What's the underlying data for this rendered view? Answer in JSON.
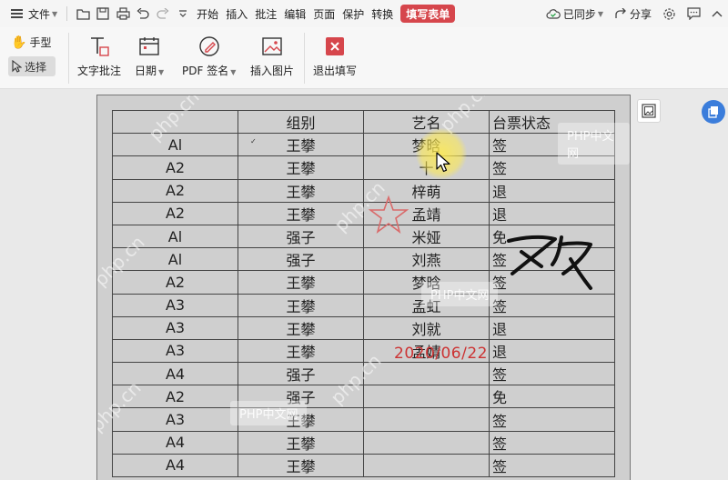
{
  "menubar": {
    "file_label": "文件",
    "tabs": [
      "开始",
      "插入",
      "批注",
      "编辑",
      "页面",
      "保护",
      "转换"
    ],
    "active_tab": "填写表单",
    "sync_label": "已同步",
    "share_label": "分享"
  },
  "ribbon": {
    "hand_label": "手型",
    "select_label": "选择",
    "text_comment_label": "文字批注",
    "date_label": "日期",
    "pdf_sign_label": "PDF 签名",
    "insert_image_label": "插入图片",
    "exit_fill_label": "退出填写"
  },
  "table": {
    "headers": [
      "",
      "组别",
      "艺名",
      "台票状态"
    ],
    "rows": [
      [
        "Al",
        "王攀",
        "梦晗",
        "签"
      ],
      [
        "A2",
        "王攀",
        "十",
        "签"
      ],
      [
        "A2",
        "王攀",
        "梓萌",
        "退"
      ],
      [
        "A2",
        "王攀",
        "孟靖",
        "退"
      ],
      [
        "Al",
        "强子",
        "米娅",
        "免"
      ],
      [
        "Al",
        "强子",
        "刘燕",
        "签"
      ],
      [
        "A2",
        "王攀",
        "梦晗",
        "签"
      ],
      [
        "A3",
        "王攀",
        "孟虹",
        "签"
      ],
      [
        "A3",
        "王攀",
        "刘就",
        "退"
      ],
      [
        "A3",
        "王攀",
        "孟婧",
        "退"
      ],
      [
        "A4",
        "强子",
        "",
        "签"
      ],
      [
        "A2",
        "强子",
        "",
        "免"
      ],
      [
        "A3",
        "王攀",
        "",
        "签"
      ],
      [
        "A4",
        "王攀",
        "",
        "签"
      ],
      [
        "A4",
        "王攀",
        "",
        "签"
      ]
    ]
  },
  "annotations": {
    "date_stamp": "2020/06/22",
    "row_tick": "✓"
  },
  "watermarks": {
    "site_text": "PHP中文网",
    "diag_text": "php.cn"
  },
  "colors": {
    "accent_red": "#d6464c",
    "stamp_red": "#cc3333",
    "float_blue": "#3b7ddb"
  }
}
